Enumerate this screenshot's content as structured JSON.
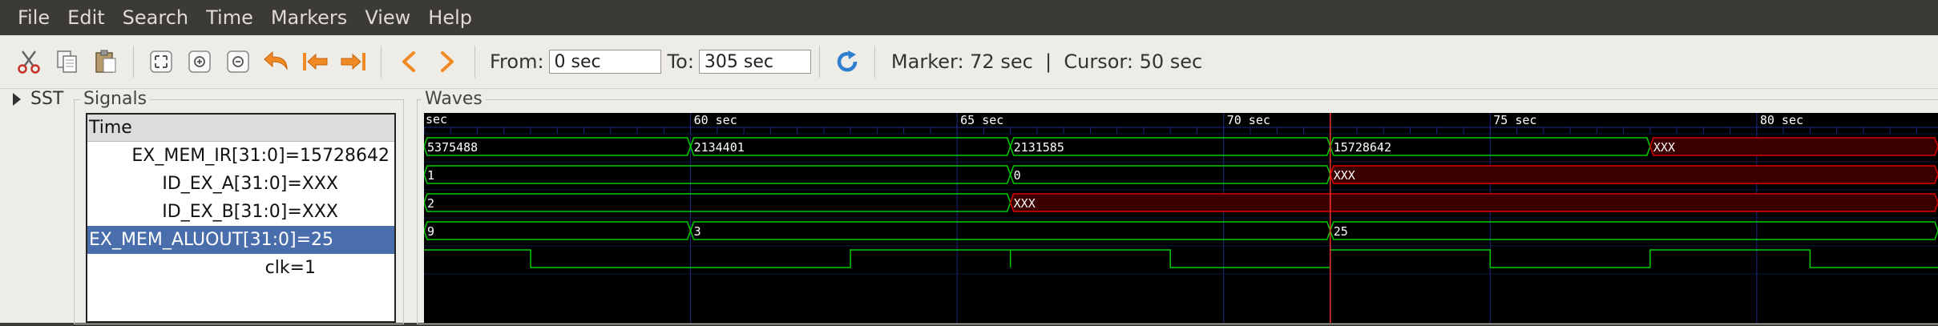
{
  "menu": [
    "File",
    "Edit",
    "Search",
    "Time",
    "Markers",
    "View",
    "Help"
  ],
  "toolbar": {
    "icons": [
      "cut-icon",
      "copy-icon",
      "paste-icon",
      "zoom-fit-icon",
      "zoom-in-icon",
      "zoom-out-icon",
      "undo-zoom-icon",
      "goto-start-icon",
      "goto-end-icon",
      "prev-icon",
      "next-icon"
    ],
    "from_label": "From:",
    "from_value": "0 sec",
    "to_label": "To:",
    "to_value": "305 sec",
    "reload_icon": "reload-icon",
    "status": "Marker: 72 sec  |  Cursor: 50 sec"
  },
  "sidebar": {
    "sst_label": "SST"
  },
  "signals": {
    "title": "Signals",
    "header": "Time",
    "rows": [
      {
        "label": "EX_MEM_IR[31:0]=15728642",
        "selected": false
      },
      {
        "label": "ID_EX_A[31:0]=XXX",
        "selected": false
      },
      {
        "label": "ID_EX_B[31:0]=XXX",
        "selected": false
      },
      {
        "label": "EX_MEM_ALUOUT[31:0]=25",
        "selected": true
      },
      {
        "label": "clk=1",
        "selected": false
      }
    ]
  },
  "waves": {
    "title": "Waves",
    "time_unit_label": "sec",
    "view_start": 55,
    "view_end": 83.4,
    "tick_labels": [
      {
        "time": 60,
        "label": "60 sec"
      },
      {
        "time": 65,
        "label": "65 sec"
      },
      {
        "time": 70,
        "label": "70 sec"
      },
      {
        "time": 75,
        "label": "75 sec"
      },
      {
        "time": 80,
        "label": "80 sec"
      }
    ],
    "marker_time": 72,
    "colors": {
      "valid": "#00cc00",
      "unknown": "#dd0000",
      "grid": "#1d2a86",
      "marker": "#ff3030",
      "text": "#ffffff",
      "background": "#000000"
    },
    "traces": [
      {
        "name": "EX_MEM_IR",
        "type": "bus",
        "segments": [
          {
            "start": 55,
            "end": 60,
            "value": "5375488",
            "state": "valid"
          },
          {
            "start": 60,
            "end": 66,
            "value": "2134401",
            "state": "valid"
          },
          {
            "start": 66,
            "end": 72,
            "value": "2131585",
            "state": "valid"
          },
          {
            "start": 72,
            "end": 78,
            "value": "15728642",
            "state": "valid"
          },
          {
            "start": 78,
            "end": 83.4,
            "value": "XXX",
            "state": "unknown"
          }
        ]
      },
      {
        "name": "ID_EX_A",
        "type": "bus",
        "segments": [
          {
            "start": 55,
            "end": 66,
            "value": "1",
            "state": "valid"
          },
          {
            "start": 66,
            "end": 72,
            "value": "0",
            "state": "valid"
          },
          {
            "start": 72,
            "end": 83.4,
            "value": "XXX",
            "state": "unknown"
          }
        ]
      },
      {
        "name": "ID_EX_B",
        "type": "bus",
        "segments": [
          {
            "start": 55,
            "end": 66,
            "value": "2",
            "state": "valid"
          },
          {
            "start": 66,
            "end": 83.4,
            "value": "XXX",
            "state": "unknown"
          }
        ]
      },
      {
        "name": "EX_MEM_ALUOUT",
        "type": "bus",
        "segments": [
          {
            "start": 55,
            "end": 60,
            "value": "9",
            "state": "valid"
          },
          {
            "start": 60,
            "end": 72,
            "value": "3",
            "state": "valid"
          },
          {
            "start": 72,
            "end": 83.4,
            "value": "25",
            "state": "valid"
          }
        ]
      },
      {
        "name": "clk",
        "type": "bit",
        "transitions": [
          {
            "time": 55,
            "level": 1
          },
          {
            "time": 57,
            "level": 0
          },
          {
            "time": 63,
            "level": 1
          },
          {
            "time": 66,
            "level": 0
          },
          {
            "time": 66,
            "level": 1
          },
          {
            "time": 69,
            "level": 0
          },
          {
            "time": 72,
            "level": 1
          },
          {
            "time": 75,
            "level": 0
          },
          {
            "time": 78,
            "level": 1
          },
          {
            "time": 81,
            "level": 0
          }
        ]
      }
    ]
  }
}
